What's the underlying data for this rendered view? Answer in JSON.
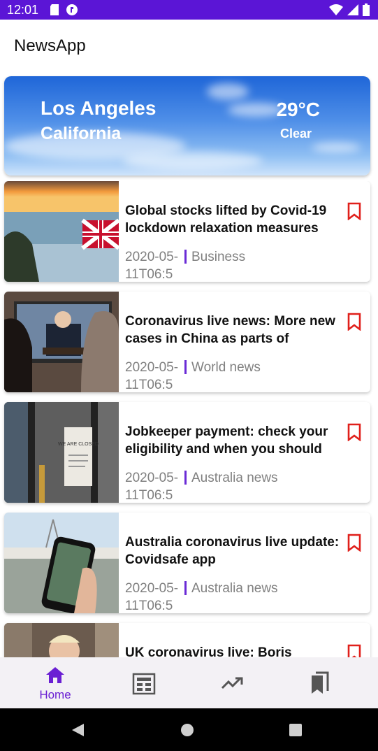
{
  "status_bar": {
    "time": "12:01"
  },
  "app_bar": {
    "title": "NewsApp"
  },
  "weather": {
    "city": "Los Angeles",
    "region": "California",
    "temperature": "29°C",
    "condition": "Clear"
  },
  "news": [
    {
      "headline": "Global stocks lifted by Covid-19 lockdown relaxation measures",
      "date": "2020-05-11T06:5",
      "category": "Business"
    },
    {
      "headline": "Coronavirus live news: More new cases in China as parts of",
      "date": "2020-05-11T06:5",
      "category": "World news"
    },
    {
      "headline": "Jobkeeper payment: check your eligibility and when you should",
      "date": "2020-05-11T06:5",
      "category": "Australia news"
    },
    {
      "headline": "Australia coronavirus live update: Covidsafe app",
      "date": "2020-05-11T06:5",
      "category": "Australia news"
    },
    {
      "headline": "UK coronavirus live: Boris",
      "date": "",
      "category": ""
    }
  ],
  "thumb_text": {
    "closed_sign": "WE ARE CLOSED"
  },
  "bottom_nav": {
    "home_label": "Home",
    "items": [
      "home-icon",
      "newspaper-icon",
      "trending-icon",
      "bookmarks-icon"
    ],
    "accent": "#6a1fd3"
  },
  "colors": {
    "status_bar": "#5b15d6",
    "bookmark": "#e0201b",
    "separator": "#6a2bd6"
  }
}
